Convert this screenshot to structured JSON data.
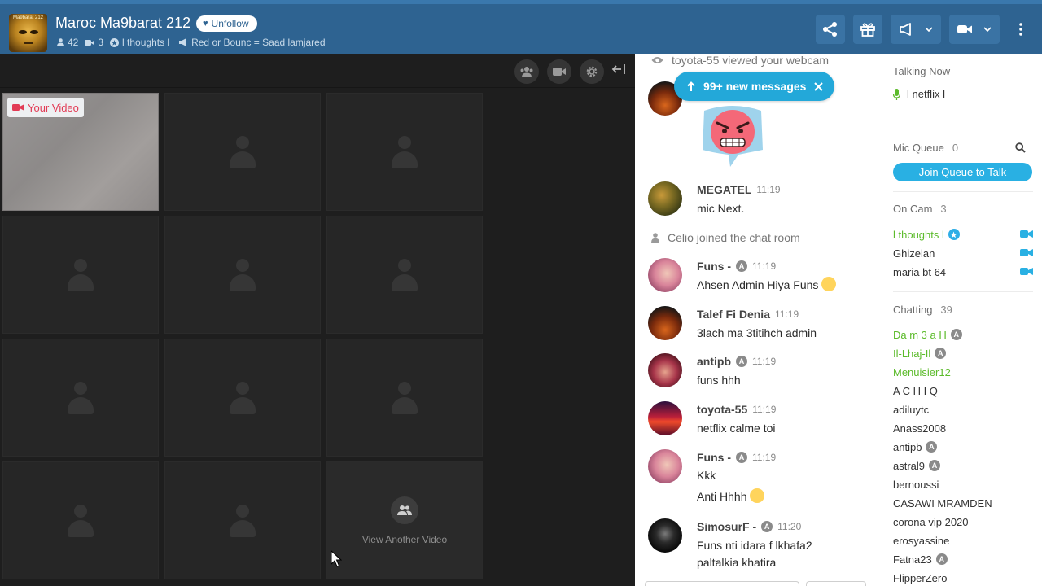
{
  "header": {
    "room_name": "Maroc Ma9barat 212",
    "avatar_caption": "Ma9barat 212",
    "unfollow_label": "Unfollow",
    "users_count": "42",
    "cams_count": "3",
    "owner": "l thoughts l",
    "announcement": "Red or Bounc = Saad lamjared",
    "accent_color": "#2e6391"
  },
  "video": {
    "your_video_label": "Your Video",
    "view_another_label": "View Another Video"
  },
  "chat": {
    "system_top": "toyota-55 viewed your webcam",
    "new_messages_label": "99+ new messages",
    "system_join": "Celio joined the chat room",
    "messages": [
      {
        "name": "MEGATEL",
        "time": "11:19",
        "lines": [
          "mic Next."
        ]
      },
      {
        "name": "Funs -",
        "time": "11:19",
        "lines": [
          "Ahsen Admin Hiya Funs"
        ]
      },
      {
        "name": "Talef Fi Denia",
        "time": "11:19",
        "lines": [
          "3lach ma 3titihch admin"
        ]
      },
      {
        "name": "antipb",
        "time": "11:19",
        "lines": [
          "funs hhh"
        ]
      },
      {
        "name": "toyota-55",
        "time": "11:19",
        "lines": [
          "netflix calme toi"
        ]
      },
      {
        "name": "Funs -",
        "time": "11:19",
        "lines": [
          "Kkk",
          "Anti Hhhh"
        ]
      },
      {
        "name": "SimosurF -",
        "time": "11:20",
        "lines": [
          "Funs nti idara f lkhafa2",
          "paltalkia khatira"
        ]
      }
    ]
  },
  "users": {
    "talking_now_title": "Talking Now",
    "talking_now_user": "l netflix l",
    "mic_queue_title": "Mic Queue",
    "mic_queue_count": "0",
    "join_queue_label": "Join Queue to Talk",
    "on_cam_title": "On Cam",
    "on_cam_count": "3",
    "on_cam": [
      "l thoughts l",
      "Ghizelan",
      "maria bt 64"
    ],
    "chatting_title": "Chatting",
    "chatting_count": "39",
    "chatting": [
      {
        "name": "Da m 3 a H",
        "admin": true,
        "green": true
      },
      {
        "name": "Il-Lhaj-Il",
        "admin": true,
        "green": true
      },
      {
        "name": "Menuisier12",
        "admin": false,
        "green": true
      },
      {
        "name": "A C H I Q",
        "admin": false,
        "green": false
      },
      {
        "name": "adiluytc",
        "admin": false,
        "green": false
      },
      {
        "name": "Anass2008",
        "admin": false,
        "green": false
      },
      {
        "name": "antipb",
        "admin": true,
        "green": false
      },
      {
        "name": "astral9",
        "admin": true,
        "green": false
      },
      {
        "name": "bernoussi",
        "admin": false,
        "green": false
      },
      {
        "name": "CASAWI MRAMDEN",
        "admin": false,
        "green": false
      },
      {
        "name": "corona vip 2020",
        "admin": false,
        "green": false
      },
      {
        "name": "erosyassine",
        "admin": false,
        "green": false
      },
      {
        "name": "Fatna23",
        "admin": true,
        "green": false
      },
      {
        "name": "FlipperZero",
        "admin": false,
        "green": false
      }
    ]
  },
  "icons": [
    "share-icon",
    "gift-icon",
    "megaphone-icon",
    "video-camera-icon",
    "more-vertical-icon",
    "user-icon",
    "settings-icon",
    "eye-icon",
    "microphone-icon",
    "search-icon"
  ]
}
